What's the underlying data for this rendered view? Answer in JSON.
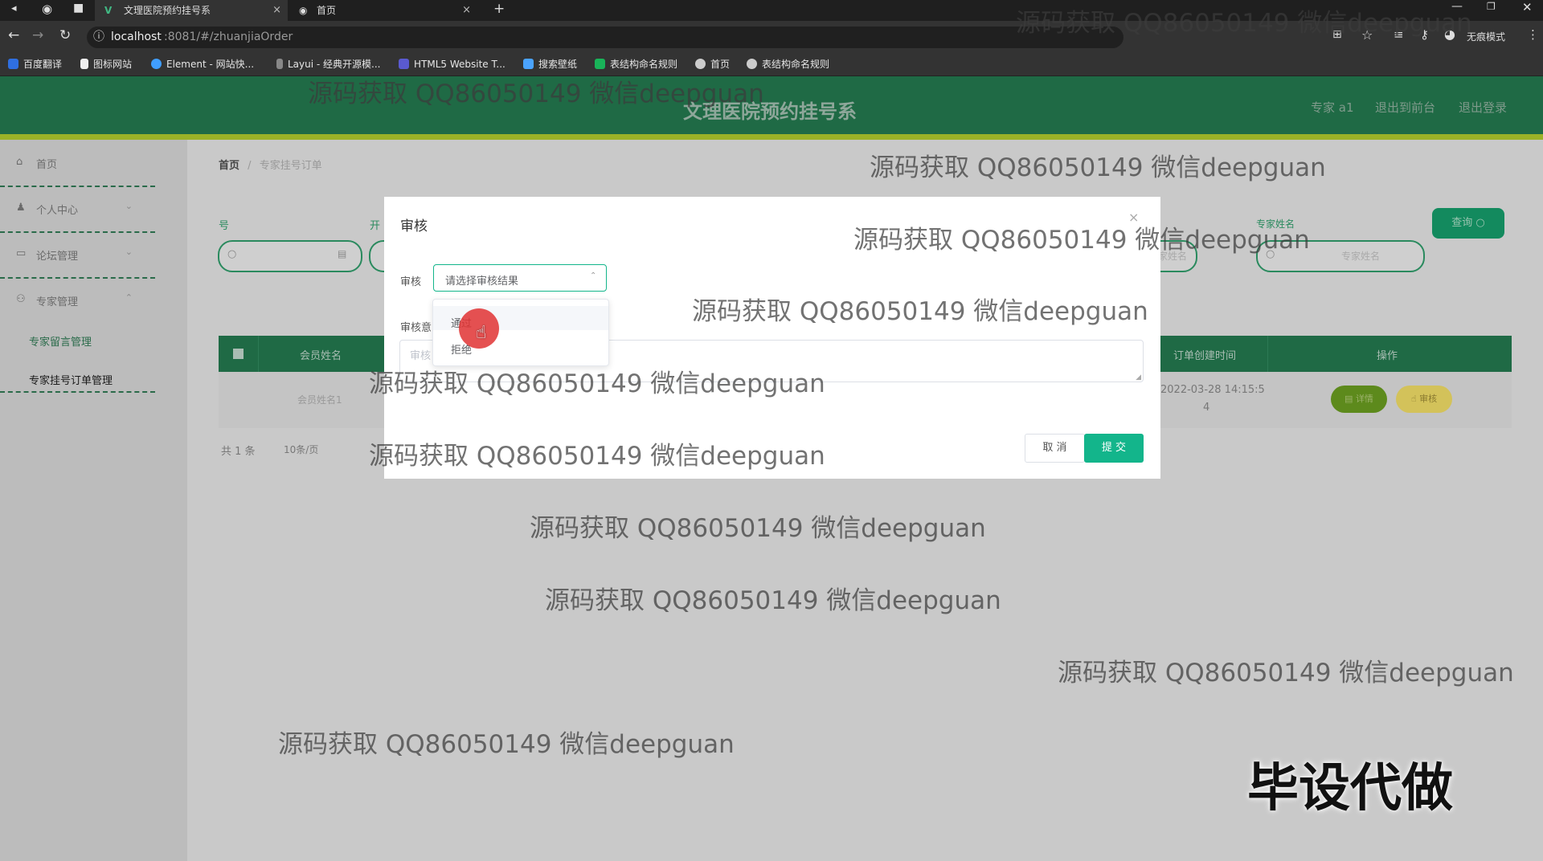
{
  "browser": {
    "tabs": [
      {
        "title": "文理医院预约挂号系",
        "close": "×"
      },
      {
        "title": "首页",
        "close": "×"
      }
    ],
    "new_tab": "+",
    "url_host": "localhost",
    "url_path": ":8081/#/zhuanjiaOrder",
    "incognito_label": "无痕模式",
    "bookmarks": [
      "百度翻译",
      "图标网站",
      "Element - 网站快...",
      "Layui - 经典开源模...",
      "HTML5 Website T...",
      "搜索壁纸",
      "表结构命名规则",
      "首页",
      "表结构命名规则"
    ]
  },
  "header": {
    "title": "文理医院预约挂号系",
    "user": "专家 a1",
    "front_link": "退出到前台",
    "logout_link": "退出登录"
  },
  "sidebar": {
    "items": [
      {
        "label": "首页",
        "icon": "home-icon"
      },
      {
        "label": "个人中心",
        "icon": "user-icon"
      },
      {
        "label": "论坛管理",
        "icon": "forum-icon"
      },
      {
        "label": "专家管理",
        "icon": "expert-icon"
      }
    ],
    "sub_items": [
      "专家留言管理",
      "专家挂号订单管理"
    ]
  },
  "breadcrumb": {
    "home": "首页",
    "sep": "/",
    "current": "专家挂号订单"
  },
  "search": {
    "label_1": "号",
    "label_2": "开",
    "label_3": "专家姓名",
    "query_button": "查询",
    "placeholder_left": "专家姓名",
    "placeholder_right": "专家姓名"
  },
  "table": {
    "headers": [
      "会员姓名",
      "订单创建时间",
      "操作"
    ],
    "row": {
      "member": "会员姓名1",
      "created": "2022-03-28 14:15:5",
      "created_tail": "4",
      "detail_btn": "详情",
      "audit_btn": "审核"
    },
    "total": "共 1 条",
    "page_size": "10条/页"
  },
  "modal": {
    "title": "审核",
    "close": "×",
    "audit_label": "审核",
    "select_placeholder": "请选择审核结果",
    "opinion_label": "审核意",
    "textarea_placeholder": "审核",
    "options": [
      "通过",
      "拒绝"
    ],
    "cancel": "取 消",
    "submit": "提 交"
  },
  "watermarks": [
    "源码获取 QQ86050149 微信deepguan",
    "源码获取 QQ86050149 微信deepguan",
    "源码获取 QQ86050149 微信deepguan",
    "源码获取 QQ86050149 微信deepguan",
    "源码获取 QQ86050149 微信deepguan",
    "源码获取 QQ86050149 微信deepguan",
    "源码获取 QQ86050149 微信deepguan",
    "源码获取 QQ86050149 微信deepguan",
    "源码获取 QQ86050149 微信deepguan",
    "源码获取 QQ86050149 微信deepguan",
    "源码获取 QQ86050149 微信deepguan"
  ],
  "stamp": "毕设代做",
  "colors": {
    "header_green": "#1f6a45",
    "accent_teal": "#13b58b",
    "lime": "#9bb227"
  }
}
